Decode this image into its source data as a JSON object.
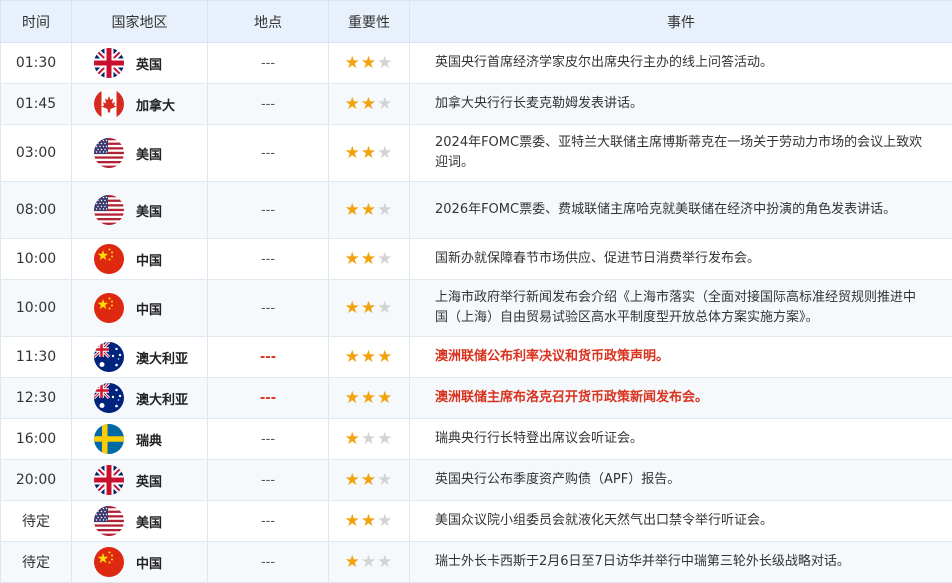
{
  "headers": {
    "time": "时间",
    "country": "国家地区",
    "location": "地点",
    "importance": "重要性",
    "event": "事件"
  },
  "colors": {
    "star_on": "#f2a20c",
    "star_off": "#d3d3d3",
    "highlight": "#d9321f",
    "header_bg": "#e8f1fb"
  },
  "rows": [
    {
      "time": "01:30",
      "flag": "uk-flag-icon",
      "country": "英国",
      "location": "---",
      "stars": 2,
      "event": "英国央行首席经济学家皮尔出席央行主办的线上问答活动。",
      "highlight": false
    },
    {
      "time": "01:45",
      "flag": "canada-flag-icon",
      "country": "加拿大",
      "location": "---",
      "stars": 2,
      "event": "加拿大央行行长麦克勒姆发表讲话。",
      "highlight": false
    },
    {
      "time": "03:00",
      "flag": "usa-flag-icon",
      "country": "美国",
      "location": "---",
      "stars": 2,
      "event": "2024年FOMC票委、亚特兰大联储主席博斯蒂克在一场关于劳动力市场的会议上致欢迎词。",
      "highlight": false
    },
    {
      "time": "08:00",
      "flag": "usa-flag-icon",
      "country": "美国",
      "location": "---",
      "stars": 2,
      "event": "2026年FOMC票委、费城联储主席哈克就美联储在经济中扮演的角色发表讲话。",
      "highlight": false
    },
    {
      "time": "10:00",
      "flag": "china-flag-icon",
      "country": "中国",
      "location": "---",
      "stars": 2,
      "event": "国新办就保障春节市场供应、促进节日消费举行发布会。",
      "highlight": false
    },
    {
      "time": "10:00",
      "flag": "china-flag-icon",
      "country": "中国",
      "location": "---",
      "stars": 2,
      "event": "上海市政府举行新闻发布会介绍《上海市落实（全面对接国际高标准经贸规则推进中国（上海）自由贸易试验区高水平制度型开放总体方案实施方案》。",
      "highlight": false
    },
    {
      "time": "11:30",
      "flag": "australia-flag-icon",
      "country": "澳大利亚",
      "location": "---",
      "stars": 3,
      "event": "澳洲联储公布利率决议和货币政策声明。",
      "highlight": true
    },
    {
      "time": "12:30",
      "flag": "australia-flag-icon",
      "country": "澳大利亚",
      "location": "---",
      "stars": 3,
      "event": "澳洲联储主席布洛克召开货币政策新闻发布会。",
      "highlight": true
    },
    {
      "time": "16:00",
      "flag": "sweden-flag-icon",
      "country": "瑞典",
      "location": "---",
      "stars": 1,
      "event": "瑞典央行行长特登出席议会听证会。",
      "highlight": false
    },
    {
      "time": "20:00",
      "flag": "uk-flag-icon",
      "country": "英国",
      "location": "---",
      "stars": 2,
      "event": "英国央行公布季度资产购债（APF）报告。",
      "highlight": false
    },
    {
      "time": "待定",
      "flag": "usa-flag-icon",
      "country": "美国",
      "location": "---",
      "stars": 2,
      "event": "美国众议院小组委员会就液化天然气出口禁令举行听证会。",
      "highlight": false
    },
    {
      "time": "待定",
      "flag": "china-flag-icon",
      "country": "中国",
      "location": "---",
      "stars": 1,
      "event": "瑞士外长卡西斯于2月6日至7日访华并举行中瑞第三轮外长级战略对话。",
      "highlight": false
    }
  ]
}
